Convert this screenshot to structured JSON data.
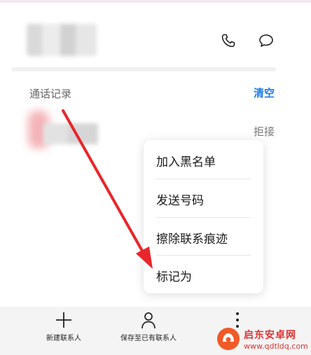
{
  "header": {
    "icons": {
      "phone": "phone-icon",
      "message": "message-icon"
    }
  },
  "call_log": {
    "title": "通话记录",
    "clear_label": "清空",
    "entries": [
      {
        "status": "拒接"
      }
    ]
  },
  "context_menu": {
    "items": [
      {
        "label": "加入黑名单"
      },
      {
        "label": "发送号码"
      },
      {
        "label": "擦除联系痕迹"
      },
      {
        "label": "标记为"
      }
    ]
  },
  "bottom_bar": {
    "new_contact": {
      "label": "新建联系人",
      "icon": "plus-icon"
    },
    "save_existing": {
      "label": "保存至已有联系人",
      "icon": "person-icon"
    },
    "more": {
      "icon": "more-icon"
    }
  },
  "watermark": {
    "title": "启东安卓网",
    "url": "www.qdtldq.com"
  },
  "colors": {
    "accent": "#1e7be8",
    "annotation_arrow": "#e8262b",
    "watermark": "#dd3333"
  }
}
